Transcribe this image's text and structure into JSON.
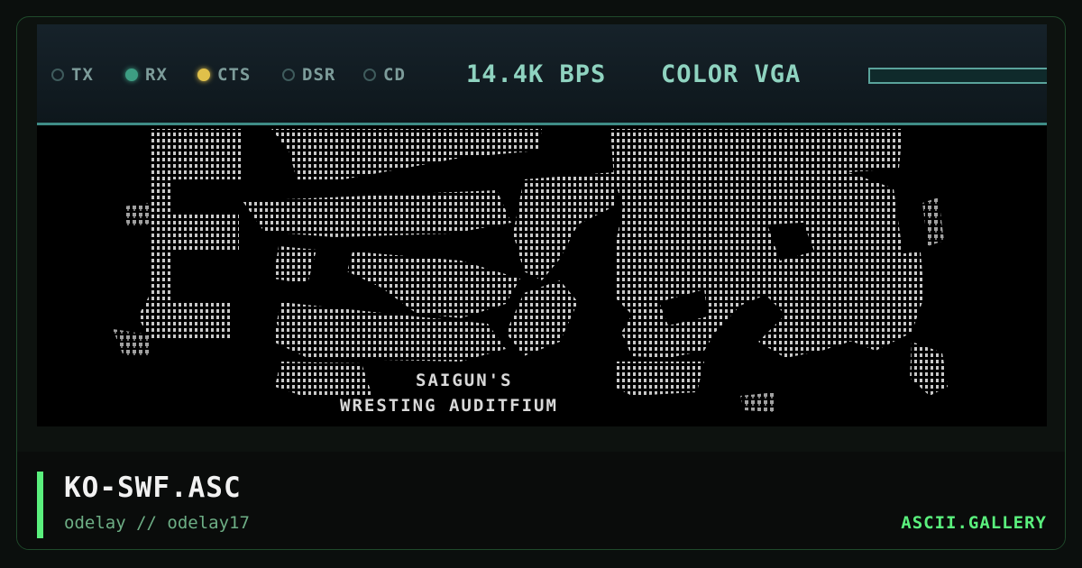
{
  "status_bar": {
    "lights": [
      {
        "label": "TX",
        "state": "off"
      },
      {
        "label": "RX",
        "state": "green"
      },
      {
        "label": "CTS",
        "state": "yellow"
      },
      {
        "label": "DSR",
        "state": "off"
      },
      {
        "label": "CD",
        "state": "off"
      }
    ],
    "baud": "14.4K BPS",
    "mode": "COLOR VGA"
  },
  "artwork": {
    "subtitle_line1": "SAIGUN'S",
    "subtitle_line2": "WRESTING AUDITFIUM"
  },
  "footer": {
    "title": "KO-SWF.ASC",
    "byline": "odelay // odelay17",
    "brand": "ASCII.GALLERY"
  },
  "colors": {
    "accent": "#5af07d",
    "screen_bg": "#000000",
    "art": "#d9d9d9",
    "status_text": "#8fd3c0"
  }
}
